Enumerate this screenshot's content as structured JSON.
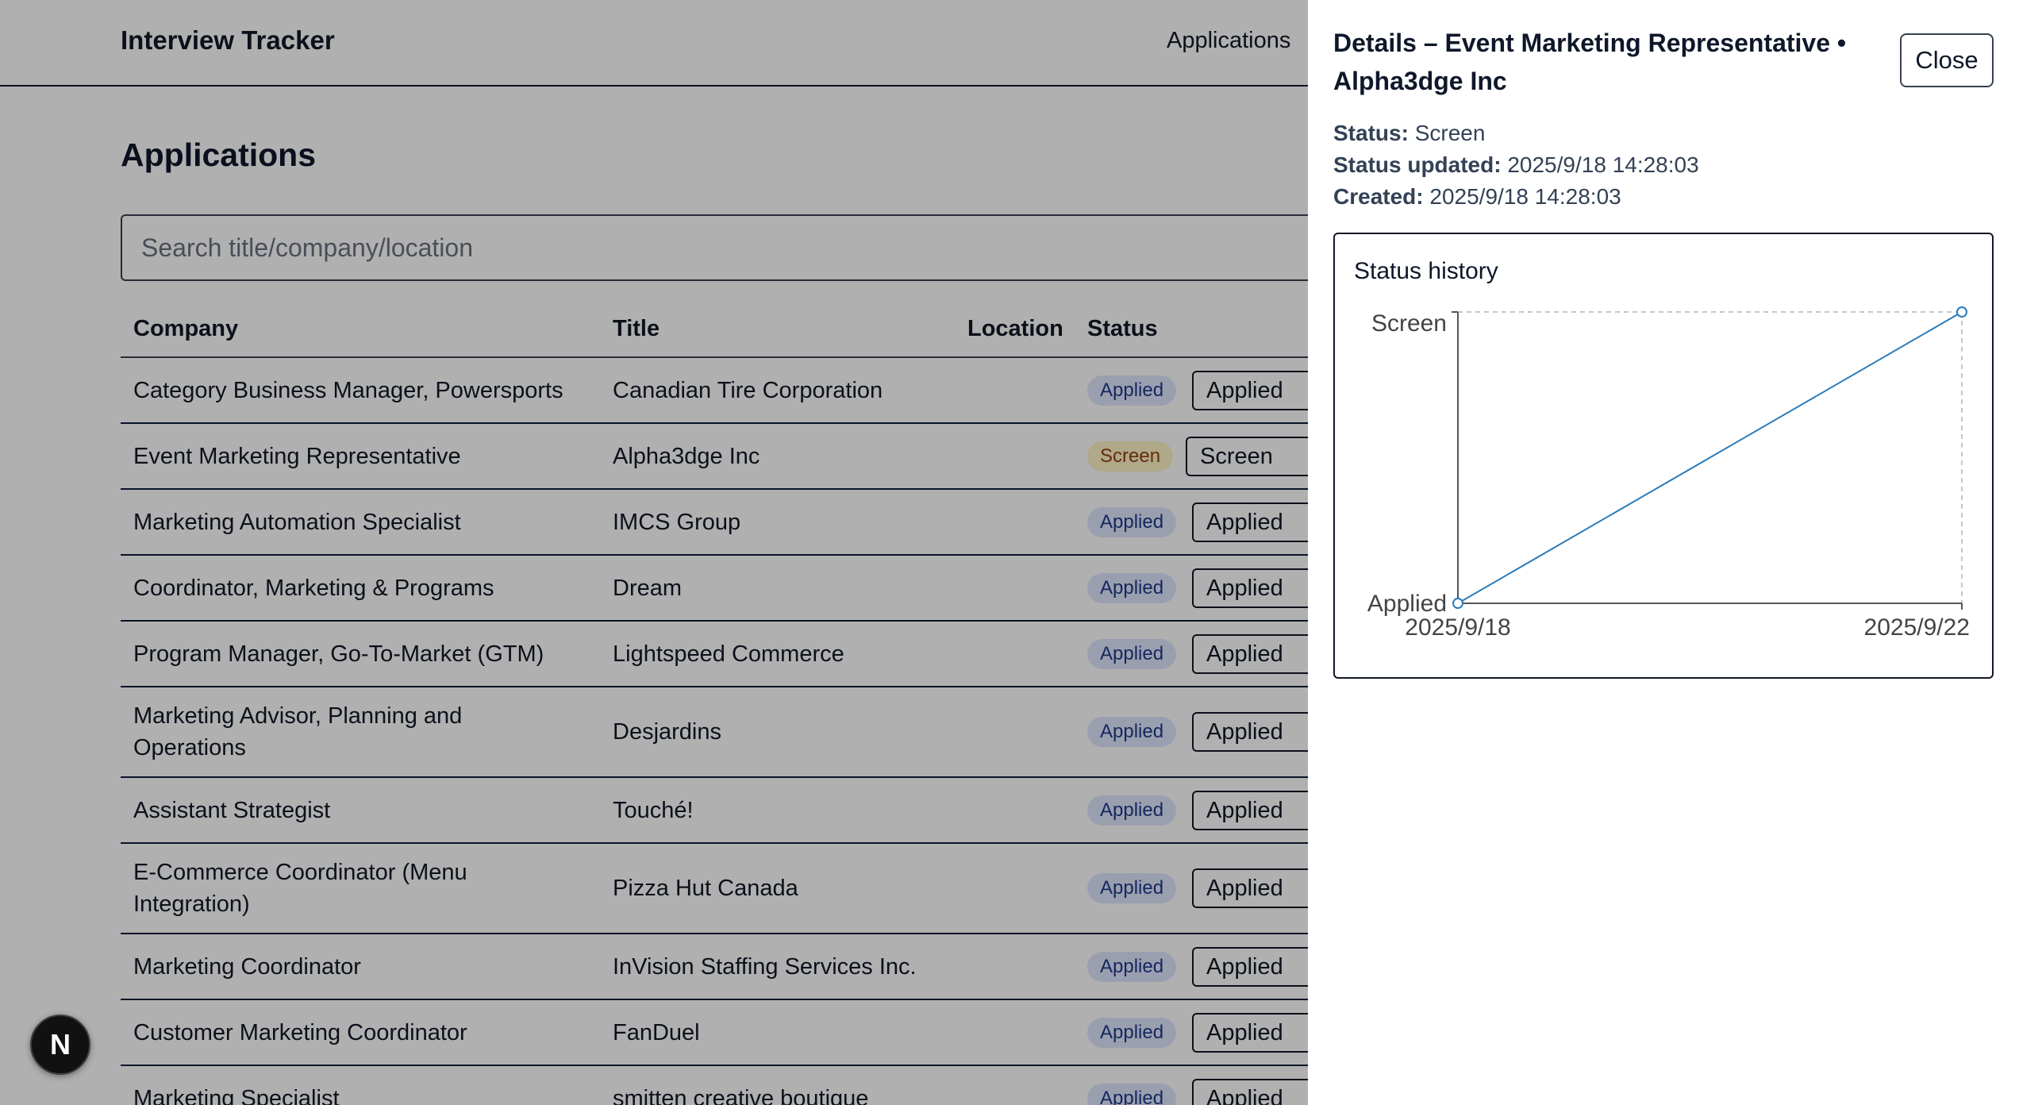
{
  "app": {
    "brand": "Interview Tracker",
    "nav_applications": "Applications"
  },
  "page": {
    "title": "Applications",
    "search_placeholder": "Search title/company/location"
  },
  "table": {
    "headers": {
      "company": "Company",
      "title": "Title",
      "location": "Location",
      "status": "Status"
    },
    "rows": [
      {
        "company": "Category Business Manager, Powersports",
        "title": "Canadian Tire Corporation",
        "status": "Applied",
        "select": "Applied"
      },
      {
        "company": "Event Marketing Representative",
        "title": "Alpha3dge Inc",
        "status": "Screen",
        "select": "Screen"
      },
      {
        "company": "Marketing Automation Specialist",
        "title": "IMCS Group",
        "status": "Applied",
        "select": "Applied"
      },
      {
        "company": "Coordinator, Marketing & Programs",
        "title": "Dream",
        "status": "Applied",
        "select": "Applied"
      },
      {
        "company": "Program Manager, Go-To-Market (GTM)",
        "title": "Lightspeed Commerce",
        "status": "Applied",
        "select": "Applied"
      },
      {
        "company": "Marketing Advisor, Planning and Operations",
        "title": "Desjardins",
        "status": "Applied",
        "select": "Applied"
      },
      {
        "company": "Assistant Strategist",
        "title": "Touché!",
        "status": "Applied",
        "select": "Applied"
      },
      {
        "company": "E-Commerce Coordinator (Menu Integration)",
        "title": "Pizza Hut Canada",
        "status": "Applied",
        "select": "Applied"
      },
      {
        "company": "Marketing Coordinator",
        "title": "InVision Staffing Services Inc.",
        "status": "Applied",
        "select": "Applied"
      },
      {
        "company": "Customer Marketing Coordinator",
        "title": "FanDuel",
        "status": "Applied",
        "select": "Applied"
      },
      {
        "company": "Marketing Specialist",
        "title": "smitten creative boutique",
        "status": "Applied",
        "select": "Applied"
      }
    ]
  },
  "dev_badge": {
    "label": "N"
  },
  "drawer": {
    "title": "Details – Event Marketing Representative • Alpha3dge Inc",
    "close_label": "Close",
    "status_label": "Status:",
    "status_value": "Screen",
    "status_updated_label": "Status updated:",
    "status_updated_value": "2025/9/18 14:28:03",
    "created_label": "Created:",
    "created_value": "2025/9/18 14:28:03",
    "history_title": "Status history"
  },
  "chart_data": {
    "type": "line",
    "y_categories": [
      "Applied",
      "Screen"
    ],
    "x_ticks": [
      "2025/9/18",
      "2025/9/22"
    ],
    "series": [
      {
        "points": [
          {
            "x": "2025/9/18",
            "y": "Applied"
          },
          {
            "x": "2025/9/22",
            "y": "Screen"
          }
        ]
      }
    ],
    "line_color": "#2b7bb9",
    "grid": false
  }
}
